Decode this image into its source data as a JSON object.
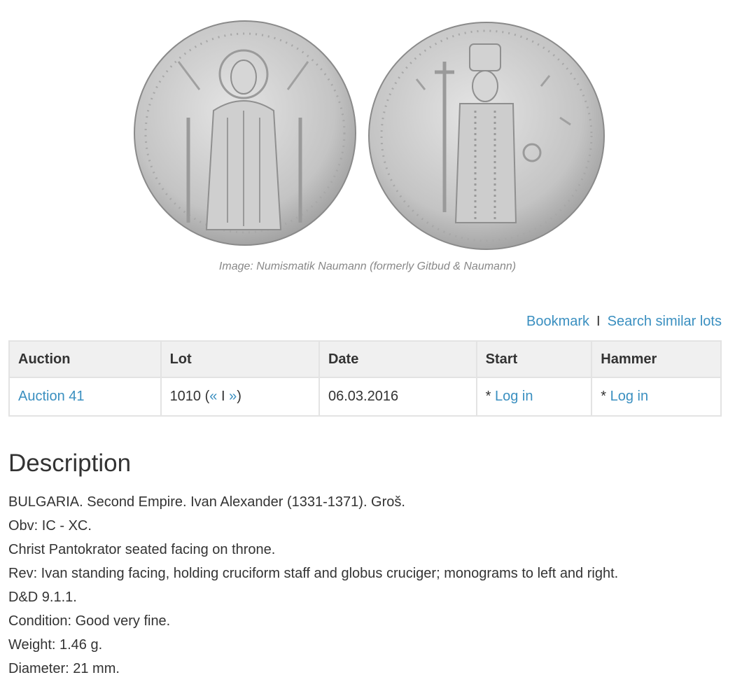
{
  "image": {
    "caption": "Image: Numismatik Naumann (formerly Gitbud & Naumann)",
    "colors": {
      "coin_silver": "#c9c9c9",
      "coin_dark": "#8a8a8a"
    }
  },
  "actions": {
    "bookmark_label": "Bookmark",
    "separator": "I",
    "search_similar_label": "Search similar lots"
  },
  "table": {
    "headers": {
      "auction": "Auction",
      "lot": "Lot",
      "date": "Date",
      "start": "Start",
      "hammer": "Hammer"
    },
    "row": {
      "auction": "Auction 41",
      "lot_number": "1010",
      "lot_open": "(",
      "prev": "«",
      "lot_sep": "I",
      "next": "»",
      "lot_close": ")",
      "date": "06.03.2016",
      "start_prefix": "* ",
      "start_link": "Log in",
      "hammer_prefix": "* ",
      "hammer_link": "Log in"
    }
  },
  "description": {
    "title": "Description",
    "lines": [
      "BULGARIA. Second Empire. Ivan Alexander (1331-1371). Groš.",
      "Obv: IC - XC.",
      "Christ Pantokrator seated facing on throne.",
      "Rev: Ivan standing facing, holding cruciform staff and globus cruciger; monograms to left and right.",
      "D&D 9.1.1.",
      "Condition: Good very fine.",
      "Weight: 1.46 g.",
      "Diameter: 21 mm."
    ]
  },
  "colors": {
    "link": "#3a8fc0",
    "text": "#333333",
    "header_bg": "#f0f0f0",
    "border": "#e3e3e3",
    "caption": "#888888"
  }
}
